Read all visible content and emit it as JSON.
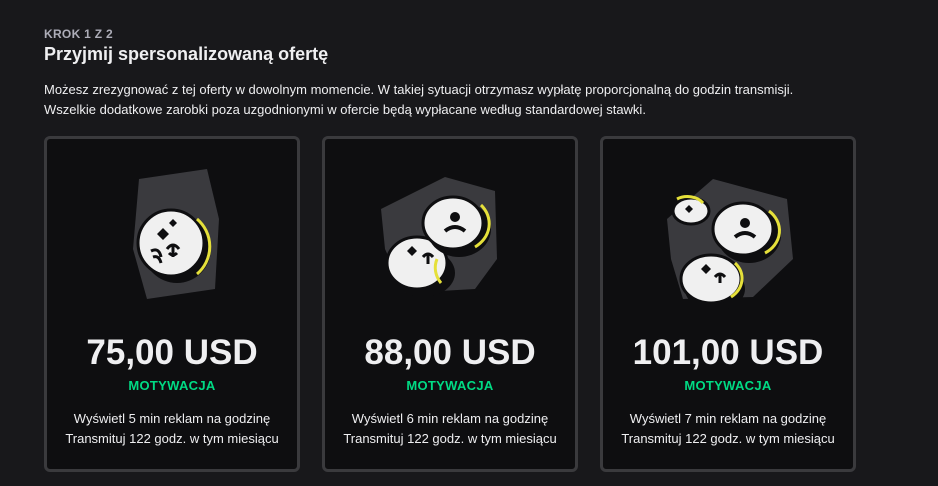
{
  "header": {
    "step": "KROK 1 Z 2",
    "title": "Przyjmij spersonalizowaną ofertę",
    "description_line1": "Możesz zrezygnować z tej oferty w dowolnym momencie. W takiej sytuacji otrzymasz wypłatę proporcjonalną do godzin transmisji.",
    "description_line2": "Wszelkie dodatkowe zarobki poza uzgodnionymi w ofercie będą wypłacane według standardowej stawki."
  },
  "colors": {
    "background": "#18181b",
    "card": "#0e0e10",
    "card_border": "#3a3a3d",
    "accent_green": "#00db84",
    "coin_ring": "#e5e03a"
  },
  "offers": [
    {
      "amount": "75,00 USD",
      "label": "MOTYWACJA",
      "line1": "Wyświetl 5 min reklam na godzinę",
      "line2": "Transmituj 122 godz. w tym miesiącu",
      "icon": "single-coin-icon"
    },
    {
      "amount": "88,00 USD",
      "label": "MOTYWACJA",
      "line1": "Wyświetl 6 min reklam na godzinę",
      "line2": "Transmituj 122 godz. w tym miesiącu",
      "icon": "two-coins-icon"
    },
    {
      "amount": "101,00 USD",
      "label": "MOTYWACJA",
      "line1": "Wyświetl 7 min reklam na godzinę",
      "line2": "Transmituj 122 godz. w tym miesiącu",
      "icon": "coin-pile-icon"
    }
  ]
}
